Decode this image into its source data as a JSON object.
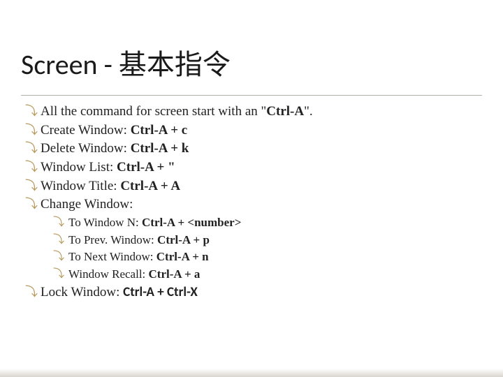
{
  "title": "Screen - 基本指令",
  "bullets": [
    {
      "textParts": [
        "All the command for screen start with an \"",
        "Ctrl-A",
        "\"."
      ],
      "bold": [
        false,
        true,
        false
      ]
    },
    {
      "textParts": [
        "Create Window: ",
        "Ctrl-A + c"
      ],
      "bold": [
        false,
        true
      ]
    },
    {
      "textParts": [
        "Delete Window: ",
        "Ctrl-A + k"
      ],
      "bold": [
        false,
        true
      ]
    },
    {
      "textParts": [
        "Window List: ",
        "Ctrl-A + \""
      ],
      "bold": [
        false,
        true
      ]
    },
    {
      "textParts": [
        "Window Title: ",
        "Ctrl-A + A"
      ],
      "bold": [
        false,
        true
      ]
    },
    {
      "textParts": [
        "Change Window:"
      ],
      "bold": [
        false
      ],
      "children": [
        {
          "textParts": [
            "To Window N: ",
            "Ctrl-A + <number>"
          ],
          "bold": [
            false,
            true
          ]
        },
        {
          "textParts": [
            "To Prev. Window: ",
            "Ctrl-A + p"
          ],
          "bold": [
            false,
            true
          ]
        },
        {
          "textParts": [
            "To Next Window: ",
            "Ctrl-A + n"
          ],
          "bold": [
            false,
            true
          ]
        },
        {
          "textParts": [
            "Window Recall: ",
            "Ctrl-A + a"
          ],
          "bold": [
            false,
            true
          ]
        }
      ]
    },
    {
      "textParts": [
        "Lock Window: ",
        "Ctrl-A + Ctrl-X"
      ],
      "bold": [
        false,
        true
      ],
      "sans": [
        false,
        true
      ]
    }
  ],
  "bulletGlyph": "⤵"
}
